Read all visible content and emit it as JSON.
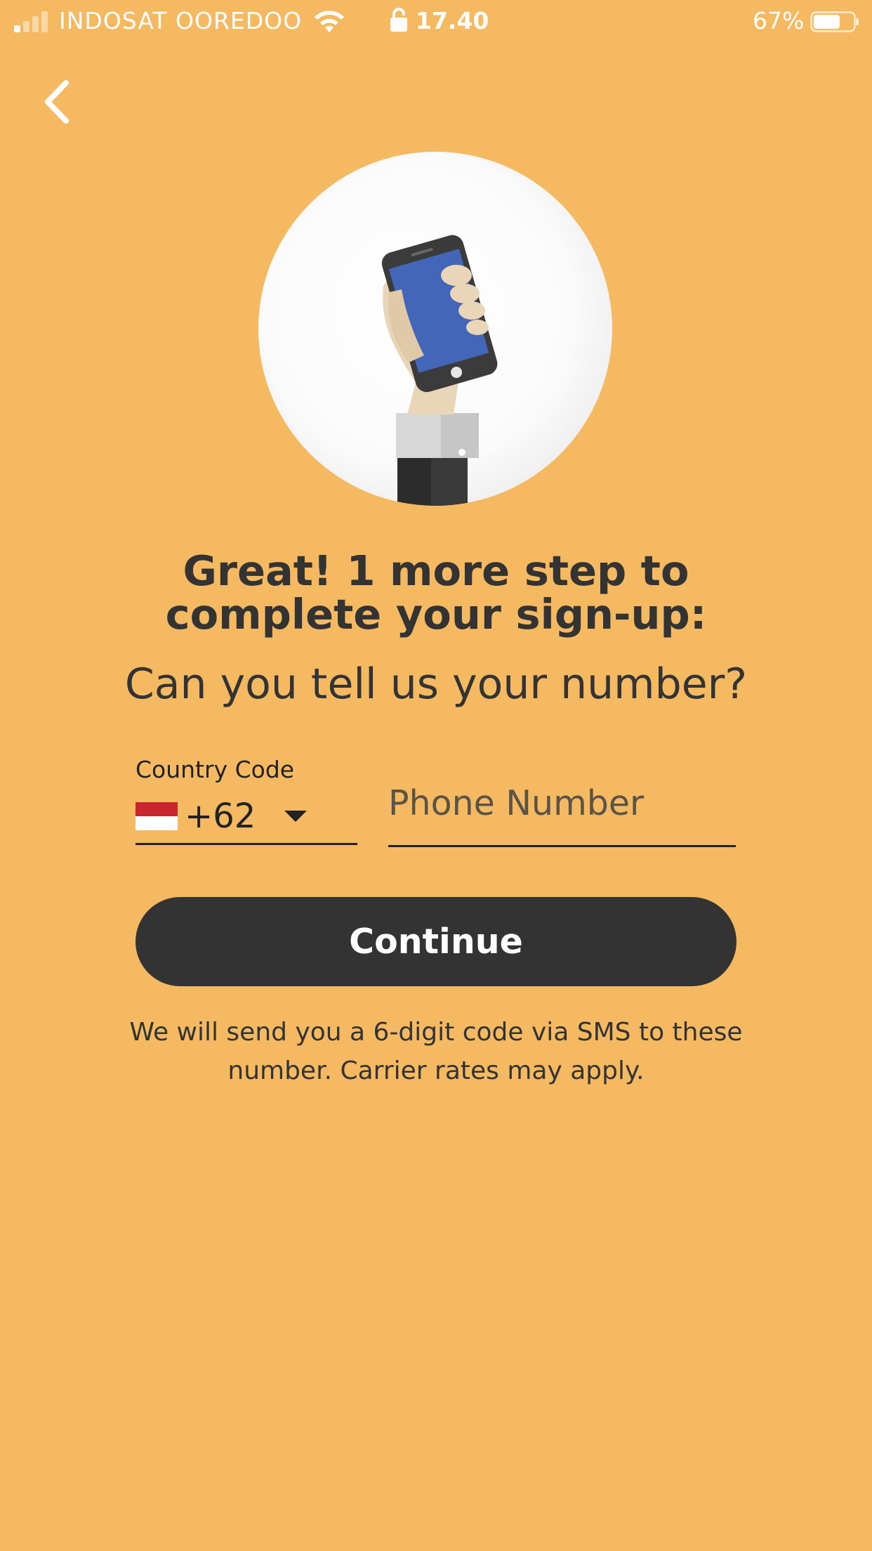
{
  "status_bar": {
    "carrier": "INDOSAT OOREDOO",
    "time": "17.40",
    "battery_percent": "67%",
    "battery_level": 0.67,
    "signal_bars_active": 1,
    "signal_bars_total": 4
  },
  "nav": {
    "back_icon": "chevron-left-icon"
  },
  "hero": {
    "illustration": "hand-holding-phone-illustration"
  },
  "headline": "Great! 1 more step to complete your sign-up:",
  "subheadline": "Can you tell us your number?",
  "country_code": {
    "label": "Country Code",
    "value": "+62",
    "flag": "indonesia-flag-icon",
    "caret_icon": "caret-down-icon"
  },
  "phone": {
    "placeholder": "Phone Number",
    "value": ""
  },
  "continue_label": "Continue",
  "sms_note": "We will send you a 6-digit code via SMS to these number. Carrier rates may apply.",
  "colors": {
    "background": "#F5B961",
    "button": "#333333",
    "text": "#333333",
    "flag_red": "#C8262C",
    "phone_screen": "#4466B8"
  }
}
